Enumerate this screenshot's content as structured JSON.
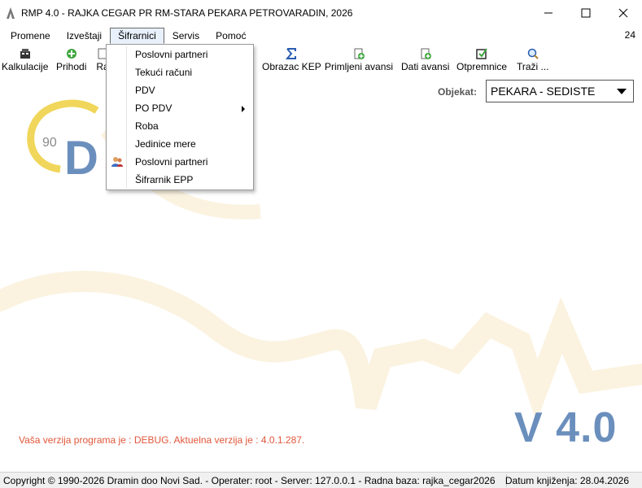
{
  "window": {
    "title": "RMP 4.0 - RAJKA CEGAR PR RM-STARA PEKARA PETROVARADIN, 2026"
  },
  "menubar": {
    "items": [
      "Promene",
      "Izveštaji",
      "Šifrarnici",
      "Servis",
      "Pomoć"
    ],
    "active": "Šifrarnici",
    "right_text": "24"
  },
  "toolbar": {
    "items": [
      {
        "label": "Kalkulacije",
        "icon": "calculator-icon"
      },
      {
        "label": "Prihodi",
        "icon": "add-green-icon"
      },
      {
        "label": "Ra",
        "icon": "document-icon"
      },
      {
        "label": "Obrazac KEP",
        "icon": "sigma-icon"
      },
      {
        "label": "Primljeni avansi",
        "icon": "document-add-icon"
      },
      {
        "label": "Dati avansi",
        "icon": "document-add-icon"
      },
      {
        "label": "Otpremnice",
        "icon": "checkbox-edit-icon"
      },
      {
        "label": "Traži ...",
        "icon": "search-icon"
      }
    ]
  },
  "dropdown": {
    "items": [
      {
        "label": "Poslovni partneri"
      },
      {
        "label": "Tekući računi"
      },
      {
        "label": "PDV"
      },
      {
        "label": "PO PDV",
        "submenu": true
      },
      {
        "label": "Roba"
      },
      {
        "label": "Jedinice mere"
      },
      {
        "label": "Poslovni partneri",
        "icon": "users-icon"
      },
      {
        "label": "Šifrarnik EPP"
      }
    ]
  },
  "objekat": {
    "label": "Objekat:",
    "value": "PEKARA - SEDISTE"
  },
  "version": {
    "message": "Vaša verzija programa je : DEBUG. Aktuelna verzija je : 4.0.1.287.",
    "big": "V 4.0"
  },
  "status": {
    "left": "Copyright © 1990-2026 Dramin doo Novi Sad. - Operater: root - Server: 127.0.0.1 - Radna baza: rajka_cegar2026",
    "right": "Datum knjiženja: 28.04.2026"
  },
  "colors": {
    "accent_blue": "#6b8fbd",
    "version_red": "#e0573a",
    "logo_yellow": "#f0d65a"
  }
}
